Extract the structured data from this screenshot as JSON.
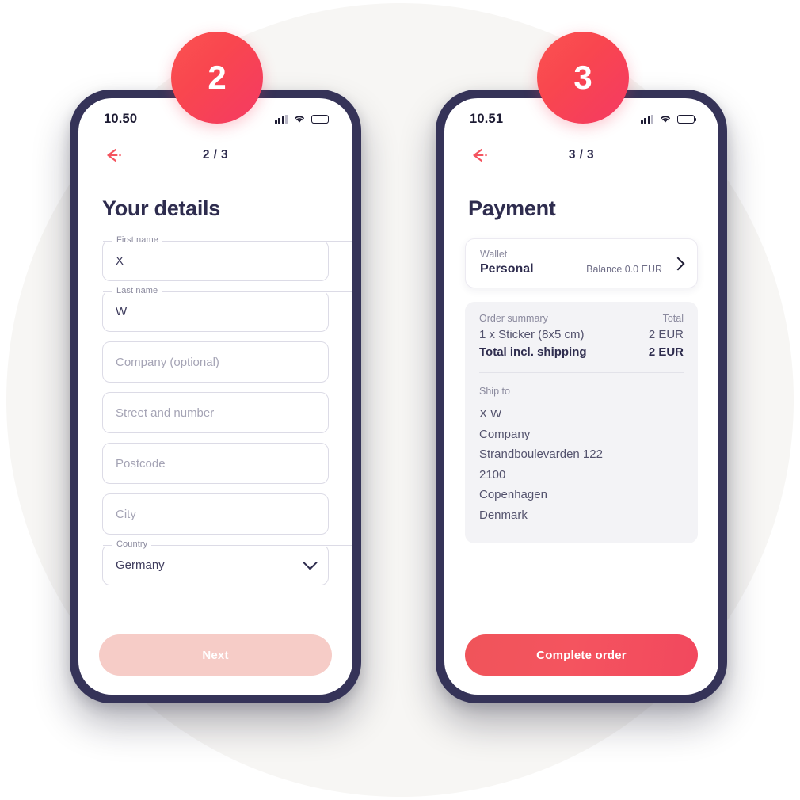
{
  "theme": {
    "accent": "#f4545f",
    "dark": "#2e2c4e",
    "frame": "#353358",
    "backdrop": "#f7f6f4",
    "muted": "#8b8a9e",
    "card_gray": "#f3f3f6",
    "disabled_button": "#f6ccc7"
  },
  "badges": [
    {
      "name": "step-2-badge",
      "value": "2"
    },
    {
      "name": "step-3-badge",
      "value": "3"
    }
  ],
  "screen_details": {
    "status": {
      "time": "10.50",
      "signal_icon": "signal-bars-icon",
      "wifi_icon": "wifi-icon",
      "battery_icon": "battery-icon"
    },
    "nav": {
      "back_icon": "back-arrow-icon",
      "step": "2 / 3"
    },
    "title": "Your details",
    "fields": [
      {
        "name": "first-name",
        "legend": "First name",
        "value": "X",
        "placeholder": "",
        "type": "text"
      },
      {
        "name": "last-name",
        "legend": "Last name",
        "value": "W",
        "placeholder": "",
        "type": "text"
      },
      {
        "name": "company",
        "legend": "",
        "value": "",
        "placeholder": "Company (optional)",
        "type": "text"
      },
      {
        "name": "street",
        "legend": "",
        "value": "",
        "placeholder": "Street and number",
        "type": "text"
      },
      {
        "name": "postcode",
        "legend": "",
        "value": "",
        "placeholder": "Postcode",
        "type": "text"
      },
      {
        "name": "city",
        "legend": "",
        "value": "",
        "placeholder": "City",
        "type": "text"
      },
      {
        "name": "country",
        "legend": "Country",
        "value": "Germany",
        "placeholder": "",
        "type": "select",
        "chevron_icon": "chevron-down-icon"
      }
    ],
    "cta": {
      "label": "Next",
      "state": "disabled"
    }
  },
  "screen_payment": {
    "status": {
      "time": "10.51",
      "signal_icon": "signal-bars-icon",
      "wifi_icon": "wifi-icon",
      "battery_icon": "battery-icon"
    },
    "nav": {
      "back_icon": "back-arrow-icon",
      "step": "3 / 3"
    },
    "title": "Payment",
    "wallet": {
      "label": "Wallet",
      "name": "Personal",
      "balance": "Balance 0.0 EUR",
      "chevron_icon": "chevron-right-icon"
    },
    "summary": {
      "header_left": "Order summary",
      "header_right": "Total",
      "items": [
        {
          "label": "1 x Sticker (8x5 cm)",
          "amount": "2 EUR"
        }
      ],
      "total_label": "Total incl. shipping",
      "total_amount": "2 EUR"
    },
    "ship_to": {
      "label": "Ship to",
      "lines": [
        "X W",
        "Company",
        "Strandboulevarden 122",
        "2100",
        "Copenhagen",
        "Denmark"
      ]
    },
    "cta": {
      "label": "Complete order",
      "state": "primary"
    }
  }
}
